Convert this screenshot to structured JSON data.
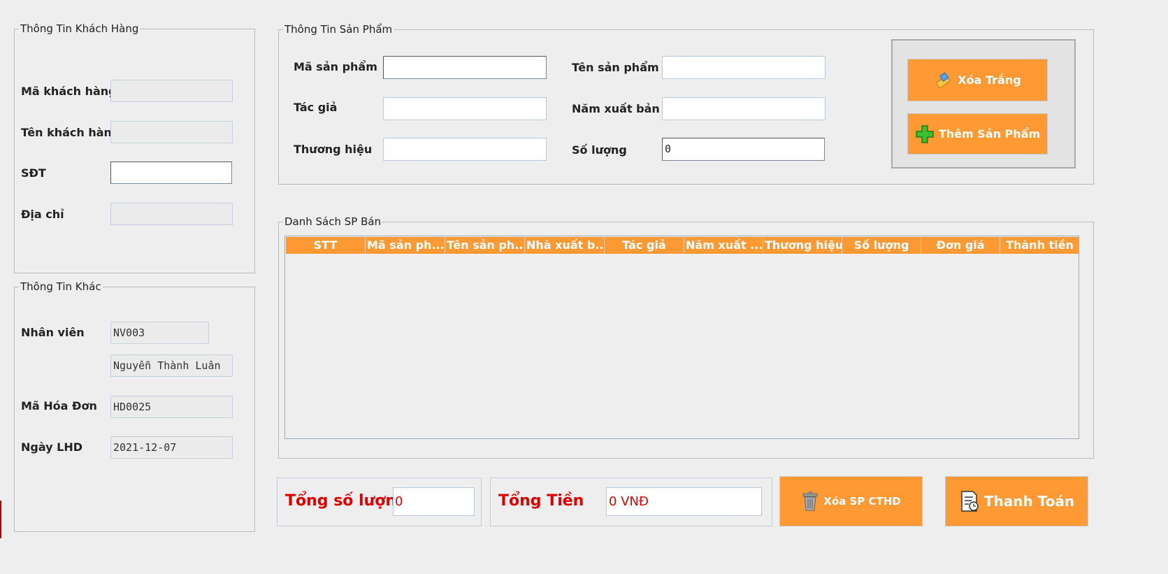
{
  "customer": {
    "legend": "Thông Tin Khách Hàng",
    "ma_kh_label": "Mã khách hàng",
    "ma_kh_value": "",
    "ten_kh_label": "Tên khách hàng",
    "ten_kh_value": "",
    "sdt_label": "SĐT",
    "sdt_value": "",
    "dia_chi_label": "Địa chỉ",
    "dia_chi_value": ""
  },
  "other": {
    "legend": "Thông Tin Khác",
    "nhan_vien_label": "Nhân viên",
    "nhan_vien_id": "NV003",
    "nhan_vien_name": "Nguyễn Thành Luân",
    "ma_hd_label": "Mã Hóa Đơn",
    "ma_hd_value": "HD0025",
    "ngay_label": "Ngày LHD",
    "ngay_value": "2021-12-07"
  },
  "product": {
    "legend": "Thông Tin Sản Phẩm",
    "ma_sp_label": "Mã sản phẩm",
    "ma_sp_value": "",
    "ten_sp_label": "Tên sản phẩm",
    "ten_sp_value": "",
    "tac_gia_label": "Tác giả",
    "tac_gia_value": "",
    "nam_xb_label": "Năm xuất bản",
    "nam_xb_value": "",
    "thuong_hieu_label": "Thương hiệu",
    "thuong_hieu_value": "",
    "so_luong_label": "Số lượng",
    "so_luong_value": "0",
    "clear_button": "Xóa Trắng",
    "add_button": "Thêm Sản Phẩm"
  },
  "sale_list": {
    "legend": "Danh Sách SP Bán",
    "columns": [
      "STT",
      "Mã sản ph...",
      "Tên sản ph...",
      "Nhà xuất b...",
      "Tác giả",
      "Năm xuất ...",
      "Thương hiệu",
      "Số lượng",
      "Đơn giá",
      "Thành tiền"
    ],
    "rows": []
  },
  "totals": {
    "qty_label": "Tổng số lượng",
    "qty_value": "0",
    "money_label": "Tổng Tiền",
    "money_value": "0 VNĐ"
  },
  "actions": {
    "delete_button": "Xóa SP CTHD",
    "pay_button": "Thanh Toán"
  },
  "colors": {
    "accent": "#ff9933",
    "total_text": "#e00000",
    "background": "#eeeeee"
  }
}
